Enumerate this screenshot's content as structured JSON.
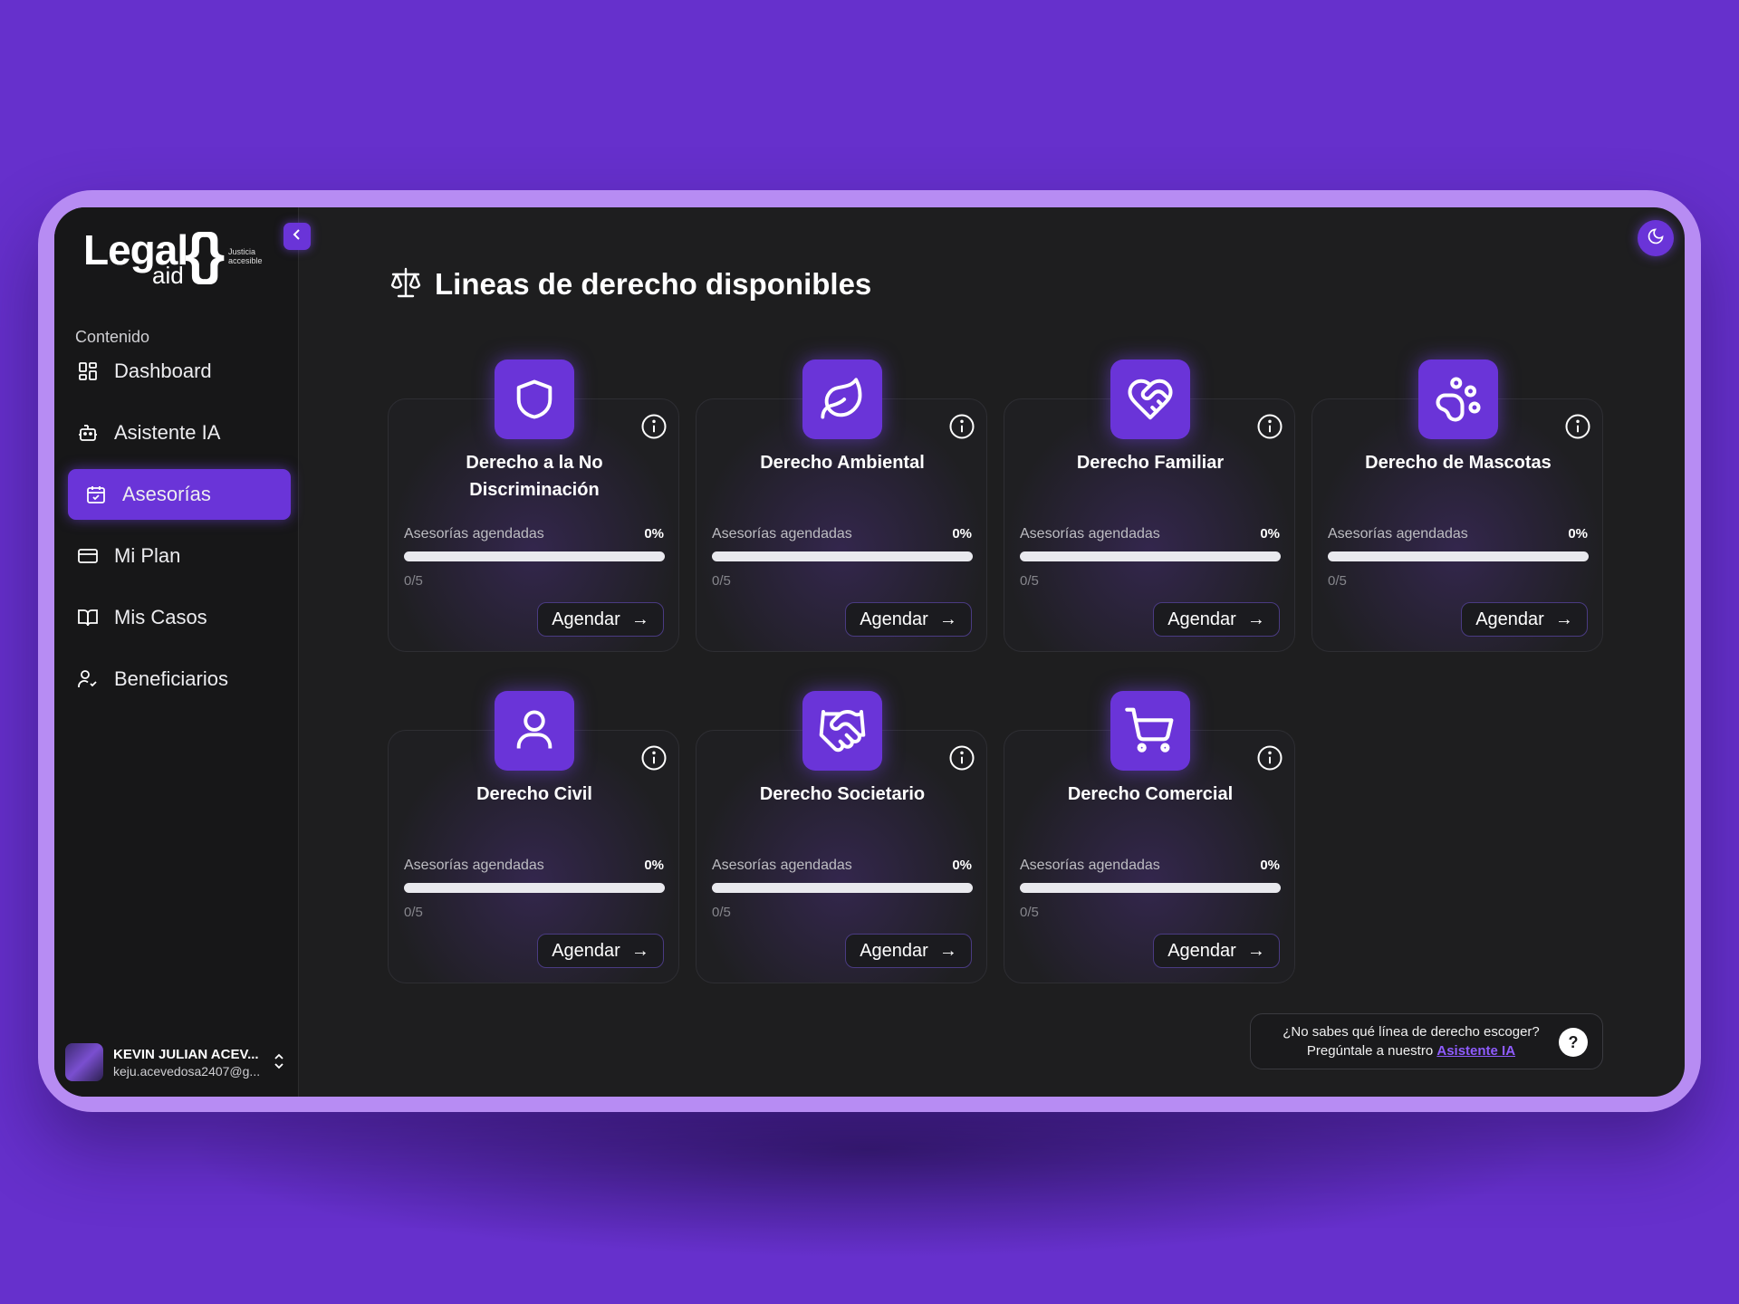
{
  "brand": {
    "name_primary": "Legal",
    "name_secondary": "aid",
    "braces": "{}",
    "tagline": "Justicia accesible"
  },
  "sidebar": {
    "section_label": "Contenido",
    "items": [
      {
        "label": "Dashboard",
        "icon": "dashboard-icon",
        "active": false
      },
      {
        "label": "Asistente IA",
        "icon": "bot-icon",
        "active": false
      },
      {
        "label": "Asesorías",
        "icon": "calendar-check-icon",
        "active": true
      },
      {
        "label": "Mi Plan",
        "icon": "credit-card-icon",
        "active": false
      },
      {
        "label": "Mis Casos",
        "icon": "book-icon",
        "active": false
      },
      {
        "label": "Beneficiarios",
        "icon": "user-check-icon",
        "active": false
      }
    ],
    "user": {
      "name": "KEVIN JULIAN ACEV...",
      "email": "keju.acevedosa2407@g..."
    }
  },
  "main": {
    "title": "Lineas de derecho disponibles",
    "cards": [
      {
        "title": "Derecho a la No Discriminación",
        "icon": "shield-icon",
        "stat_label": "Asesorías agendadas",
        "percent": "0%",
        "progress": 0,
        "count": "0/5",
        "button": "Agendar"
      },
      {
        "title": "Derecho Ambiental",
        "icon": "leaf-icon",
        "stat_label": "Asesorías agendadas",
        "percent": "0%",
        "progress": 0,
        "count": "0/5",
        "button": "Agendar"
      },
      {
        "title": "Derecho Familiar",
        "icon": "heart-handshake-icon",
        "stat_label": "Asesorías agendadas",
        "percent": "0%",
        "progress": 0,
        "count": "0/5",
        "button": "Agendar"
      },
      {
        "title": "Derecho de Mascotas",
        "icon": "paw-icon",
        "stat_label": "Asesorías agendadas",
        "percent": "0%",
        "progress": 0,
        "count": "0/5",
        "button": "Agendar"
      },
      {
        "title": "Derecho Civil",
        "icon": "user-icon",
        "stat_label": "Asesorías agendadas",
        "percent": "0%",
        "progress": 0,
        "count": "0/5",
        "button": "Agendar"
      },
      {
        "title": "Derecho Societario",
        "icon": "handshake-icon",
        "stat_label": "Asesorías agendadas",
        "percent": "0%",
        "progress": 0,
        "count": "0/5",
        "button": "Agendar"
      },
      {
        "title": "Derecho Comercial",
        "icon": "cart-icon",
        "stat_label": "Asesorías agendadas",
        "percent": "0%",
        "progress": 0,
        "count": "0/5",
        "button": "Agendar"
      }
    ],
    "help": {
      "line1": "¿No sabes qué línea de derecho escoger?",
      "line2_prefix": "Pregúntale a nuestro",
      "link": "Asistente IA",
      "button": "?"
    }
  },
  "colors": {
    "background": "#6630cc",
    "accent": "#6a34d8",
    "screen": "#1e1e1f",
    "frame": "#b78cf3"
  }
}
